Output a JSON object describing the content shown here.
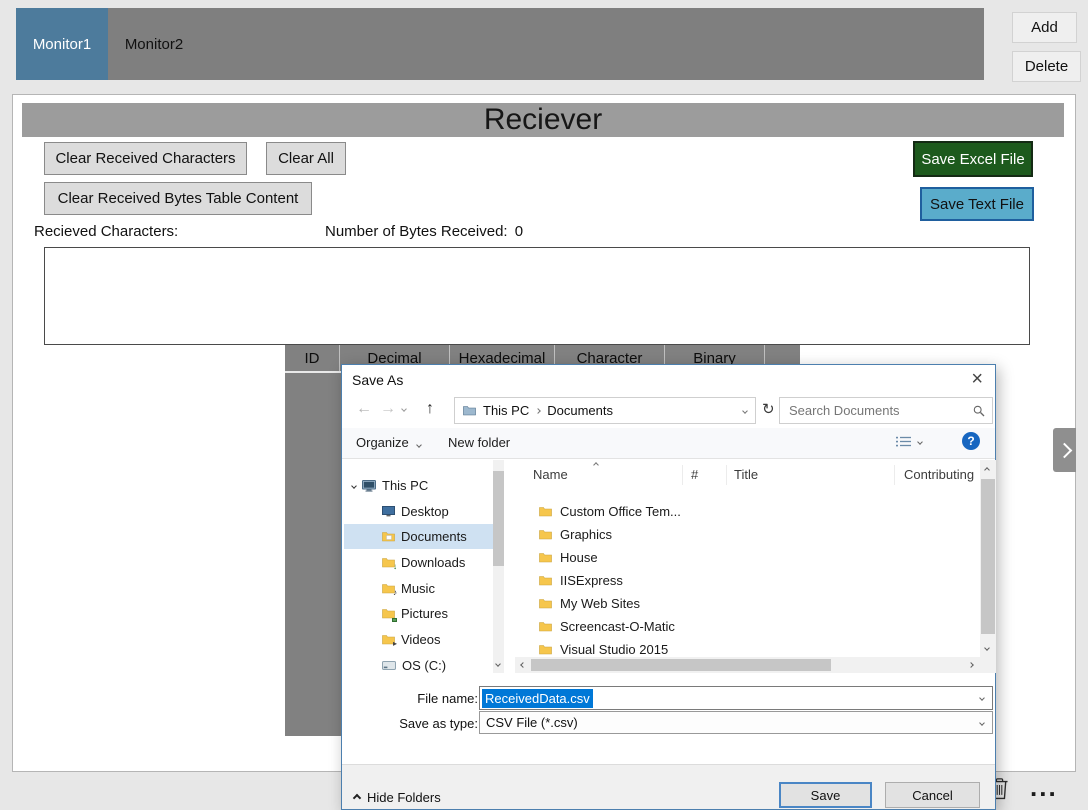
{
  "app": {
    "tabs": [
      {
        "label": "Monitor1"
      },
      {
        "label": "Monitor2"
      }
    ],
    "add_button": "Add",
    "delete_button": "Delete",
    "more_options": "..."
  },
  "receiver": {
    "title": "Reciever",
    "buttons": {
      "clear_received_characters": "Clear Received Characters",
      "clear_all": "Clear All",
      "save_excel_file": "Save Excel File",
      "clear_received_bytes_table": "Clear Received Bytes Table Content",
      "save_text_file": "Save Text File"
    },
    "labels": {
      "received_characters": "Recieved Characters:",
      "bytes_received": "Number of Bytes Received:",
      "bytes_received_count": "0"
    },
    "table": {
      "headers": [
        "ID",
        "Decimal",
        "Hexadecimal",
        "Character",
        "Binary"
      ]
    },
    "colors": {
      "save_excel_bg": "#1d5a1d",
      "save_text_bg": "#5aaccb",
      "tab_active_bg": "#4d7b9c"
    }
  },
  "save_dialog": {
    "title": "Save As",
    "icons": {
      "close": "×",
      "back": "←",
      "forward": "→",
      "up": "↑",
      "refresh": "↻",
      "help": "?"
    },
    "nav": {
      "breadcrumb": [
        "This PC",
        "Documents"
      ],
      "search_placeholder": "Search Documents"
    },
    "toolbar": {
      "organize": "Organize",
      "new_folder": "New folder"
    },
    "sidebar": {
      "items": [
        {
          "label": "This PC",
          "icon": "computer-icon"
        },
        {
          "label": "Desktop",
          "icon": "desktop-icon"
        },
        {
          "label": "Documents",
          "icon": "documents-folder-icon"
        },
        {
          "label": "Downloads",
          "icon": "downloads-folder-icon"
        },
        {
          "label": "Music",
          "icon": "music-folder-icon"
        },
        {
          "label": "Pictures",
          "icon": "pictures-folder-icon"
        },
        {
          "label": "Videos",
          "icon": "videos-folder-icon"
        },
        {
          "label": "OS (C:)",
          "icon": "drive-icon"
        }
      ]
    },
    "file_list": {
      "columns": [
        "Name",
        "#",
        "Title",
        "Contributing"
      ],
      "folders": [
        "Custom Office Tem...",
        "Graphics",
        "House",
        "IISExpress",
        "My Web Sites",
        "Screencast-O-Matic",
        "Visual Studio 2015"
      ]
    },
    "file_name": {
      "label": "File name:",
      "value": "ReceivedData.csv"
    },
    "save_as_type": {
      "label": "Save as type:",
      "value": "CSV File (*.csv)"
    },
    "footer": {
      "hide_folders": "Hide Folders",
      "save": "Save",
      "cancel": "Cancel"
    }
  }
}
